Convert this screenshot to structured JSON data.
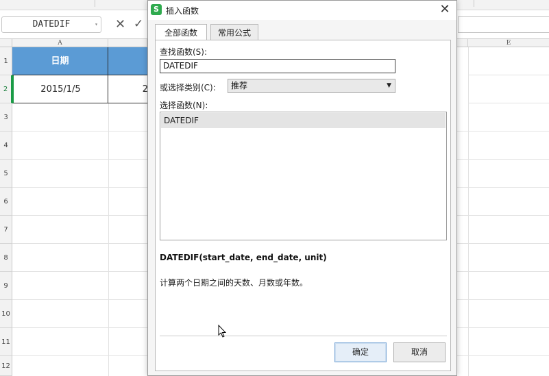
{
  "formula_bar": {
    "name_box": "DATEDIF",
    "cancel_symbol": "✕",
    "confirm_symbol": "✓"
  },
  "sheet": {
    "columns": [
      {
        "label": "A"
      },
      {
        "label": "E"
      }
    ],
    "rows": [
      "1",
      "2",
      "3",
      "4",
      "5",
      "6",
      "7",
      "8",
      "9",
      "10",
      "11",
      "12"
    ],
    "cells": {
      "A1": "日期",
      "A2": "2015/1/5",
      "B2": "2"
    },
    "header_fill_color": "#5b9bd5"
  },
  "dialog": {
    "title": "插入函数",
    "app_icon_letter": "S",
    "app_icon_color": "#2faa4e",
    "tabs": [
      {
        "label": "全部函数",
        "active": true
      },
      {
        "label": "常用公式",
        "active": false
      }
    ],
    "search_label": "查找函数(S):",
    "search_value": "DATEDIF",
    "category_label": "或选择类别(C):",
    "category_value": "推荐",
    "list_label": "选择函数(N):",
    "functions": [
      "DATEDIF"
    ],
    "signature": "DATEDIF(start_date, end_date, unit)",
    "description": "计算两个日期之间的天数、月数或年数。",
    "ok_label": "确定",
    "cancel_label": "取消"
  }
}
